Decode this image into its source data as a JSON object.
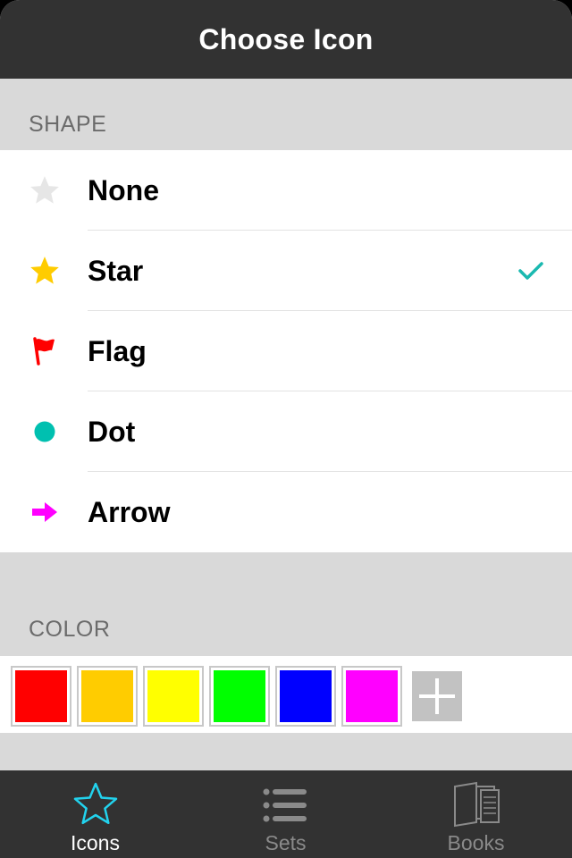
{
  "navbar": {
    "title": "Choose Icon"
  },
  "sections": {
    "shape": "SHAPE",
    "color": "COLOR"
  },
  "shapes": [
    {
      "label": "None",
      "icon": "star-outline-icon",
      "color": "#e6e6e6",
      "selected": false
    },
    {
      "label": "Star",
      "icon": "star-icon",
      "color": "#ffcc00",
      "selected": true
    },
    {
      "label": "Flag",
      "icon": "flag-icon",
      "color": "#ff0000",
      "selected": false
    },
    {
      "label": "Dot",
      "icon": "dot-icon",
      "color": "#00c0b0",
      "selected": false
    },
    {
      "label": "Arrow",
      "icon": "arrow-right-icon",
      "color": "#ff00ff",
      "selected": false
    }
  ],
  "accent": "#1ab9b0",
  "colors": [
    "#ff0000",
    "#ffcc00",
    "#ffff00",
    "#00ff00",
    "#0000ff",
    "#ff00ff"
  ],
  "tabs": [
    {
      "label": "Icons",
      "icon": "star-outline-icon",
      "active": true
    },
    {
      "label": "Sets",
      "icon": "list-icon",
      "active": false
    },
    {
      "label": "Books",
      "icon": "books-icon",
      "active": false
    }
  ]
}
